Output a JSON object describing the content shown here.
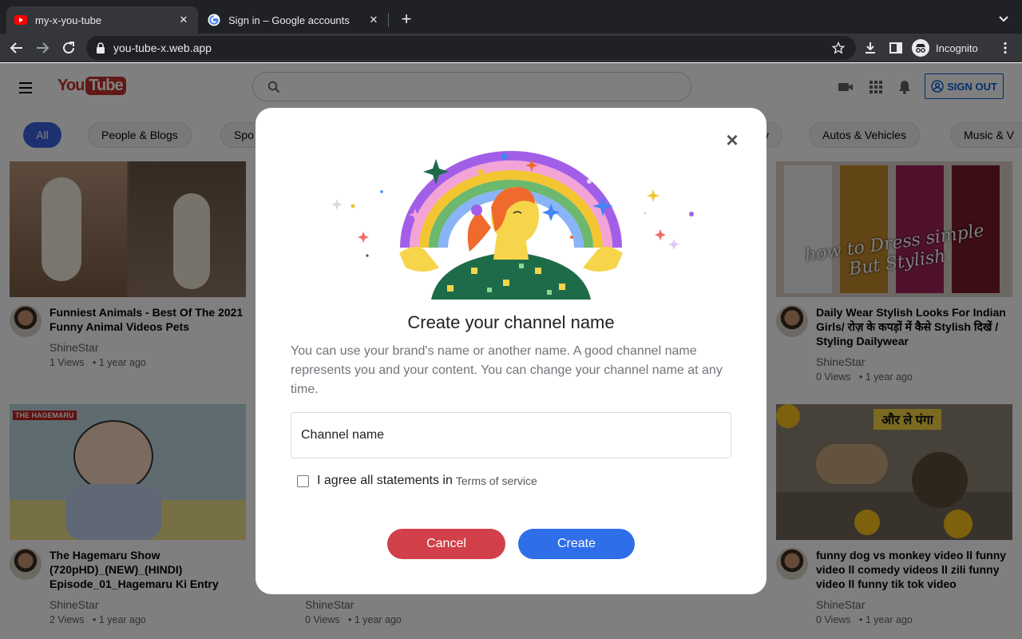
{
  "browser": {
    "tabs": [
      {
        "title": "my-x-you-tube",
        "active": true,
        "favicon": "youtube-icon"
      },
      {
        "title": "Sign in – Google accounts",
        "active": false,
        "favicon": "google-icon"
      }
    ],
    "url": "you-tube-x.web.app",
    "profile_label": "Incognito"
  },
  "header": {
    "logo_you": "You",
    "logo_tube": "Tube",
    "search_placeholder": "",
    "signout_label": "SIGN OUT"
  },
  "chips": [
    "All",
    "People & Blogs",
    "Spo",
    "y",
    "Autos & Vehicles",
    "Music & V"
  ],
  "videos": [
    {
      "title": "Funniest Animals - Best Of The 2021 Funny Animal Videos Pets",
      "channel": "ShineStar",
      "views": "1 Views",
      "age": "• 1 year ago"
    },
    {
      "title": "Daily Wear Stylish Looks For Indian Girls/ रोज़ के कपड़ों में कैसे Stylish दिखें / Styling Dailywear",
      "channel": "ShineStar",
      "views": "0 Views",
      "age": "• 1 year ago",
      "thumb_text": "how to Dress simple But Stylish"
    },
    {
      "title": "The Hagemaru Show (720pHD)_(NEW)_(HINDI) Episode_01_Hagemaru Ki Entry",
      "channel": "ShineStar",
      "views": "2 Views",
      "age": "• 1 year ago"
    },
    {
      "title": "",
      "channel": "ShineStar",
      "views": "0 Views",
      "age": "• 1 year ago"
    },
    {
      "title": "funny dog vs monkey video ll funny video ll comedy videos ll zili funny video ll funny tik tok video",
      "channel": "ShineStar",
      "views": "0 Views",
      "age": "• 1 year ago",
      "thumb_text": "और ले पंगा"
    }
  ],
  "modal": {
    "title": "Create your channel name",
    "description": "You can use your brand's name or another name. A good channel name represents you and your content. You can change your channel name at any time.",
    "field_placeholder": "Channel name",
    "agree_text": "I agree all statements in",
    "tos_link": "Terms of service",
    "cancel_label": "Cancel",
    "create_label": "Create",
    "close_symbol": "×"
  },
  "colors": {
    "cancel": "#d2404a",
    "create": "#2e6ee8",
    "chip_active": "#3a63e0",
    "brand_red": "#c4302b"
  }
}
